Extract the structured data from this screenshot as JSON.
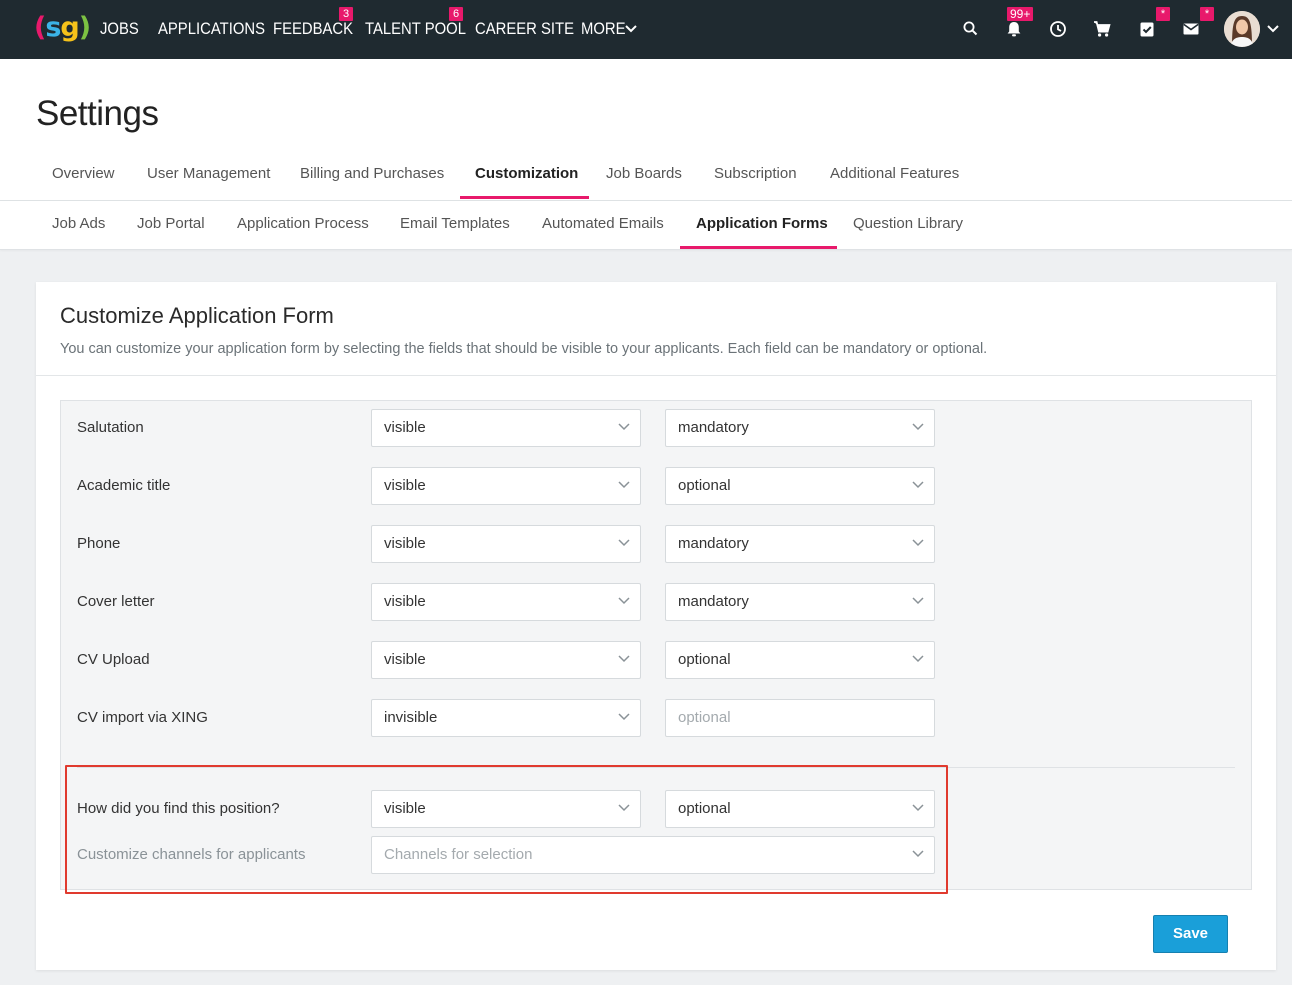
{
  "topnav": {
    "logo": {
      "p1": "(",
      "s": "s",
      "g": "g",
      "p2": ")"
    },
    "items": [
      {
        "label": "JOBS"
      },
      {
        "label": "APPLICATIONS"
      },
      {
        "label": "FEEDBACK",
        "badge": "3"
      },
      {
        "label": "TALENT POOL",
        "badge": "6"
      },
      {
        "label": "CAREER SITE"
      },
      {
        "label": "MORE"
      }
    ],
    "notifications_badge": "99+",
    "tasks_badge": "*",
    "mail_badge": "*",
    "brand_color": "#e8196b",
    "nav_bg": "#1f2a30"
  },
  "header": {
    "title": "Settings",
    "tabs": [
      {
        "label": "Overview"
      },
      {
        "label": "User Management"
      },
      {
        "label": "Billing and Purchases"
      },
      {
        "label": "Customization",
        "active": true
      },
      {
        "label": "Job Boards"
      },
      {
        "label": "Subscription"
      },
      {
        "label": "Additional Features"
      }
    ]
  },
  "subnav": {
    "tabs": [
      {
        "label": "Job Ads"
      },
      {
        "label": "Job Portal"
      },
      {
        "label": "Application Process"
      },
      {
        "label": "Email Templates"
      },
      {
        "label": "Automated Emails"
      },
      {
        "label": "Application Forms",
        "active": true
      },
      {
        "label": "Question Library"
      }
    ]
  },
  "card": {
    "title": "Customize Application Form",
    "description": "You can customize your application form by selecting the fields that should be visible to your applicants. Each field can be mandatory or optional."
  },
  "fields": [
    {
      "label": "Salutation",
      "visibility": "visible",
      "requirement": "mandatory"
    },
    {
      "label": "Academic title",
      "visibility": "visible",
      "requirement": "optional"
    },
    {
      "label": "Phone",
      "visibility": "visible",
      "requirement": "mandatory"
    },
    {
      "label": "Cover letter",
      "visibility": "visible",
      "requirement": "mandatory"
    },
    {
      "label": "CV Upload",
      "visibility": "visible",
      "requirement": "optional"
    },
    {
      "label": "CV import via XING",
      "visibility": "invisible",
      "requirement": "optional"
    }
  ],
  "source_question": {
    "label": "How did you find this position?",
    "visibility": "visible",
    "requirement": "optional",
    "channels_label": "Customize channels for applicants",
    "channels_placeholder": "Channels for selection"
  },
  "actions": {
    "save_label": "Save",
    "save_color": "#1a9fd9"
  },
  "highlight_color": "#e03a2e"
}
